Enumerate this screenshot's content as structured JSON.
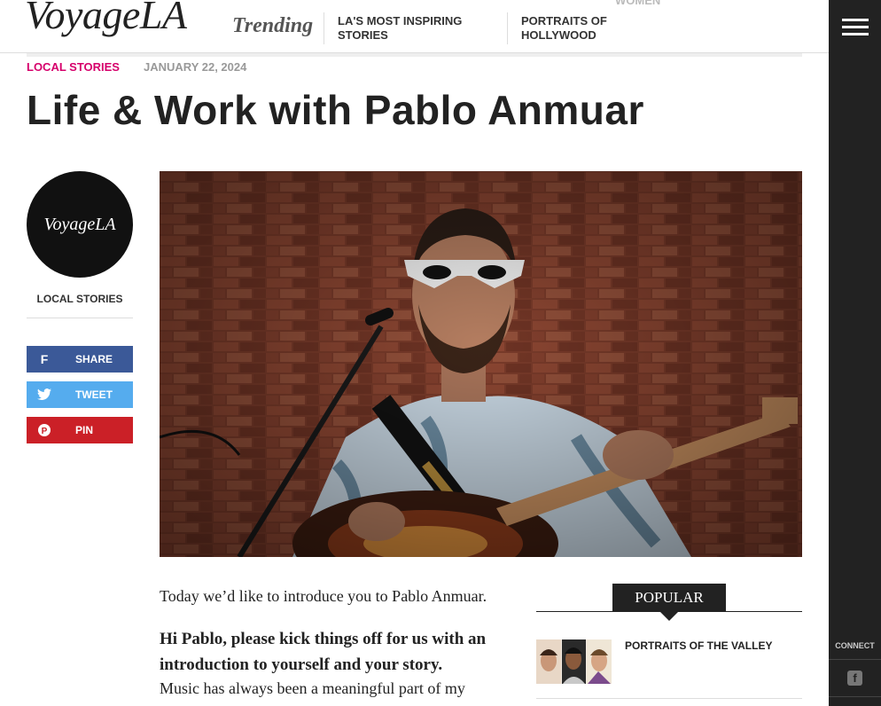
{
  "header": {
    "logo": "VoyageLA",
    "trending_label": "Trending",
    "trending_links": [
      "LA'S MOST INSPIRING STORIES",
      "PORTRAITS OF HOLLYWOOD"
    ],
    "ghost_fragment": "WOMEN"
  },
  "article": {
    "category": "LOCAL STORIES",
    "date": "JANUARY 22, 2024",
    "title": "Life & Work with Pablo Anmuar",
    "intro": "Today we’d like to introduce you to Pablo Anmuar.",
    "question": "Hi Pablo, please kick things off for us with an introduction to yourself and your story.",
    "answer_start": "Music has always been a meaningful part of my"
  },
  "author": {
    "avatar_text": "VoyageLA",
    "category": "LOCAL STORIES"
  },
  "share": {
    "facebook": {
      "label": "SHARE",
      "icon": "facebook-icon"
    },
    "twitter": {
      "label": "TWEET",
      "icon": "twitter-icon"
    },
    "pinterest": {
      "label": "PIN",
      "icon": "pinterest-icon"
    }
  },
  "popular": {
    "heading": "POPULAR",
    "items": [
      {
        "title": "PORTRAITS OF THE VALLEY"
      }
    ]
  },
  "rail": {
    "connect_label": "CONNECT",
    "icons": [
      "hamburger-menu-icon",
      "facebook-icon"
    ]
  },
  "colors": {
    "accent": "#d6006b",
    "facebook": "#3b5998",
    "twitter": "#55acee",
    "pinterest": "#cb2027",
    "rail": "#222222"
  }
}
